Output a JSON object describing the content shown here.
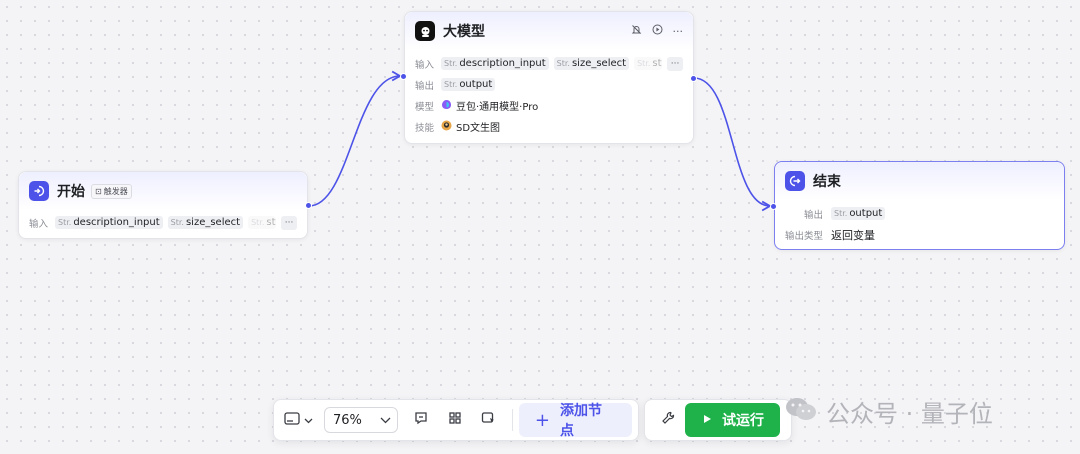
{
  "colors": {
    "accent": "#4d53e8",
    "start_icon_bg": "#4d53e8",
    "llm_icon_bg": "#111111",
    "end_icon_bg": "#4d53e8",
    "run_green": "#1fb24a"
  },
  "icons": {
    "start": "login-arrow-icon",
    "llm": "robot-icon",
    "end": "logout-arrow-icon",
    "debug_off": "bell-off-icon",
    "play": "play-circle-icon",
    "more": "ellipsis-icon",
    "minimap": "minimap-icon",
    "comment": "comment-icon",
    "layout": "grid-layout-icon",
    "select": "pointer-select-icon",
    "plus": "plus-icon",
    "wrench": "wrench-icon",
    "run": "play-triangle-icon",
    "wechat": "wechat-icon"
  },
  "nodes": {
    "start": {
      "title": "开始",
      "badge": "触发器",
      "input_label": "输入",
      "inputs": [
        {
          "type": "Str.",
          "name": "description_input"
        },
        {
          "type": "Str.",
          "name": "size_select"
        },
        {
          "type": "Str.",
          "name": "sty"
        }
      ],
      "more": "···"
    },
    "llm": {
      "title": "大模型",
      "input_label": "输入",
      "inputs": [
        {
          "type": "Str.",
          "name": "description_input"
        },
        {
          "type": "Str.",
          "name": "size_select"
        },
        {
          "type": "Str.",
          "name": "sty"
        }
      ],
      "more": "···",
      "output_label": "输出",
      "output": {
        "type": "Str.",
        "name": "output"
      },
      "model_label": "模型",
      "model_value": "豆包·通用模型·Pro",
      "skill_label": "技能",
      "skill_value": "SD文生图"
    },
    "end": {
      "title": "结束",
      "output_label": "输出",
      "output": {
        "type": "Str.",
        "name": "output"
      },
      "output_type_label": "输出类型",
      "output_type_value": "返回变量"
    }
  },
  "toolbar": {
    "zoom": "76%",
    "add_node_label": "添加节点",
    "run_label": "试运行"
  },
  "watermark": "公众号 · 量子位"
}
